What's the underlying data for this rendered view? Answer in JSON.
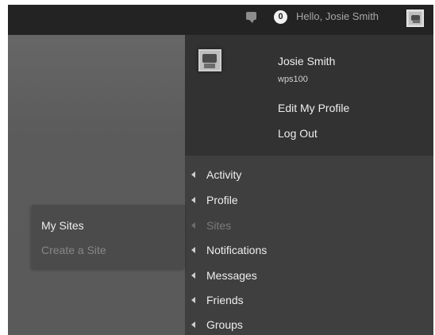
{
  "admin_bar": {
    "comments_count": "0",
    "greeting": "Hello, Josie Smith"
  },
  "account": {
    "display_name": "Josie Smith",
    "username": "wps100",
    "edit_profile": "Edit My Profile",
    "log_out": "Log Out"
  },
  "buddypress_menu": {
    "items": [
      {
        "label": "Activity",
        "state": "normal"
      },
      {
        "label": "Profile",
        "state": "normal"
      },
      {
        "label": "Sites",
        "state": "hover"
      },
      {
        "label": "Notifications",
        "state": "normal"
      },
      {
        "label": "Messages",
        "state": "normal"
      },
      {
        "label": "Friends",
        "state": "normal"
      },
      {
        "label": "Groups",
        "state": "normal"
      }
    ]
  },
  "sites_submenu": {
    "items": [
      {
        "label": "My Sites",
        "state": "normal"
      },
      {
        "label": "Create a Site",
        "state": "dim"
      }
    ]
  },
  "colors": {
    "adminbar_bg": "#232323",
    "profile_panel_bg": "#323232",
    "menu_panel_bg": "#3f3f3f",
    "flyout_bg": "#4b4b4b",
    "text_light": "#eeeeee",
    "text_dim": "#7b7b7b"
  },
  "icons": {
    "comments": "comment-bubble-icon",
    "arrow": "triangle-left-icon",
    "avatar": "robot-avatar-icon"
  }
}
